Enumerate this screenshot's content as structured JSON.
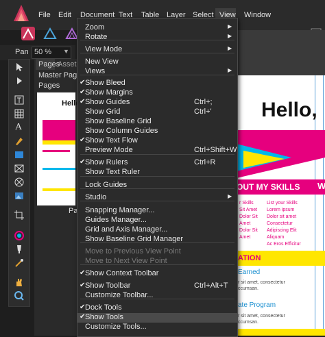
{
  "menubar": {
    "items": [
      "File",
      "Edit",
      "Document",
      "Text",
      "Table",
      "Layer",
      "Select",
      "View",
      "Window"
    ]
  },
  "context_toolbar": {
    "tool_label": "Pan",
    "zoom_value": "50 %"
  },
  "pages_panel": {
    "tabs": [
      "Pages",
      "Assets"
    ],
    "master_pages": "Master Pages",
    "pages": "Pages",
    "thumb_label": "Pag",
    "thumb_title": "Hello,"
  },
  "document_preview": {
    "hello": "Hello,",
    "skills_heading": "OUT MY SKILLS",
    "skills_col1": [
      "r Skills",
      "Sit Amet",
      "Dolor Sit",
      "Amet",
      "Dolor Sit",
      "Amet"
    ],
    "skills_col2": [
      "List your Skills",
      "Lorem ipsum",
      "Dolor sit amet",
      "Consectetur",
      "Adipiscing Elit",
      "Aliquam",
      "Ac Eros Efficitur"
    ],
    "education": "ATION",
    "earned": "Earned",
    "lorem": "r sit amet, consectetur",
    "lorem2": "ccumsan.",
    "program": "ate Program",
    "lorem3": "r sit amet, consectetur",
    "lorem4": "ccumsan.",
    "side_letter": "W"
  },
  "view_menu": {
    "items": [
      {
        "label": "Zoom",
        "submenu": true
      },
      {
        "label": "Rotate",
        "submenu": true
      },
      {
        "label": "View Mode",
        "submenu": true
      },
      {
        "label": "New View"
      },
      {
        "label": "Views",
        "submenu": true
      },
      {
        "label": "Show Bleed",
        "checked": true
      },
      {
        "label": "Show Margins",
        "checked": true
      },
      {
        "label": "Show Guides",
        "checked": true,
        "shortcut": "Ctrl+;"
      },
      {
        "label": "Show Grid",
        "shortcut": "Ctrl+'"
      },
      {
        "label": "Show Baseline Grid"
      },
      {
        "label": "Show Column Guides"
      },
      {
        "label": "Show Text Flow",
        "checked": true
      },
      {
        "label": "Preview Mode",
        "shortcut": "Ctrl+Shift+W"
      },
      {
        "label": "Show Rulers",
        "checked": true,
        "shortcut": "Ctrl+R"
      },
      {
        "label": "Show Text Ruler"
      },
      {
        "label": "Lock Guides"
      },
      {
        "label": "Studio",
        "submenu": true
      },
      {
        "label": "Snapping Manager..."
      },
      {
        "label": "Guides Manager..."
      },
      {
        "label": "Grid and Axis Manager..."
      },
      {
        "label": "Show Baseline Grid Manager"
      },
      {
        "label": "Move to Previous View Point",
        "disabled": true
      },
      {
        "label": "Move to Next View Point",
        "disabled": true
      },
      {
        "label": "Show Context Toolbar",
        "checked": true
      },
      {
        "label": "Show Toolbar",
        "checked": true,
        "shortcut": "Ctrl+Alt+T"
      },
      {
        "label": "Customize Toolbar..."
      },
      {
        "label": "Dock Tools",
        "checked": true
      },
      {
        "label": "Show Tools",
        "checked": true,
        "highlighted": true
      },
      {
        "label": "Customize Tools..."
      }
    ]
  },
  "colors": {
    "accent_pink": "#e6007e",
    "accent_yellow": "#ffe600",
    "accent_cyan": "#00b7eb",
    "menu_bg": "#2b2b2b"
  }
}
